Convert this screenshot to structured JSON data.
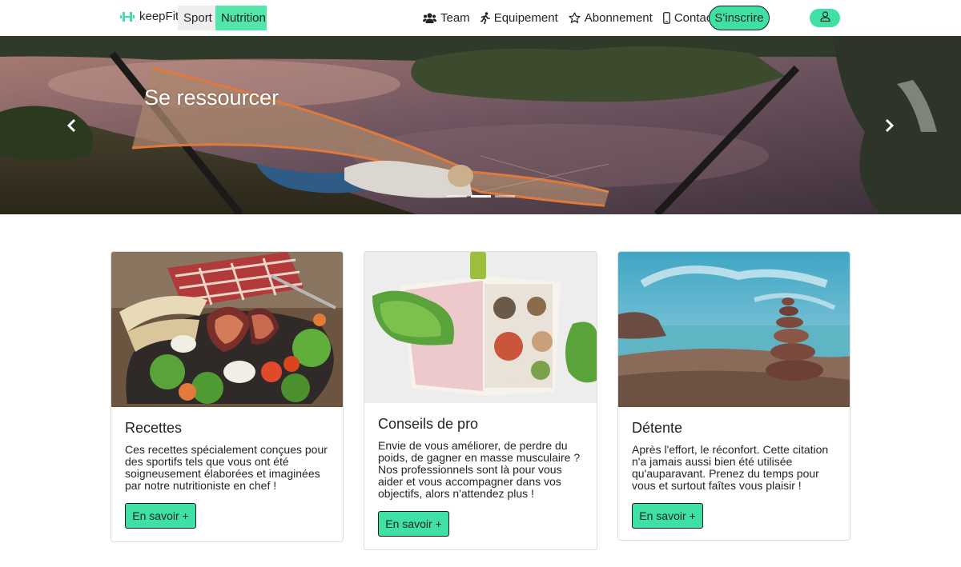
{
  "nav": {
    "brand": "keepFit",
    "sport": "Sport",
    "nutrition": "Nutrition",
    "links": [
      {
        "label": "Team",
        "icon": "users-icon"
      },
      {
        "label": "Equipement",
        "icon": "runner-icon"
      },
      {
        "label": "Abonnement",
        "icon": "star-icon"
      },
      {
        "label": "Contact",
        "icon": "mobile-phone-icon"
      }
    ],
    "signup": "S'inscrire",
    "user_icon": "user-icon"
  },
  "hero": {
    "caption": "Se ressourcer",
    "indicator_count": 3,
    "active_indicator": 1
  },
  "cards": [
    {
      "title": "Recettes",
      "text": "Ces recettes spécialement conçues pour des sportifs tels que vous ont été soigneusement élaborées et imaginées par notre nutritioniste en chef !",
      "button": "En savoir +"
    },
    {
      "title": "Conseils de pro",
      "text": "Envie de vous améliorer, de perdre du poids, de gagner en masse musculaire ? Nos professionnels sont là pour vous aider et vous accompagner dans vos objectifs, alors n'attendez plus !",
      "button": "En savoir +"
    },
    {
      "title": "Détente",
      "text": "Après l'effort, le réconfort. Cette citation n'a jamais aussi bien été utilisée qu'auparavant. Prenez du temps pour vous et surtout faîtes vous plaisir !",
      "button": "En savoir +"
    }
  ],
  "colors": {
    "accent": "#3fe0a4",
    "nutrition_bg": "#52e6a8",
    "sport_bg": "#eeeeee"
  }
}
